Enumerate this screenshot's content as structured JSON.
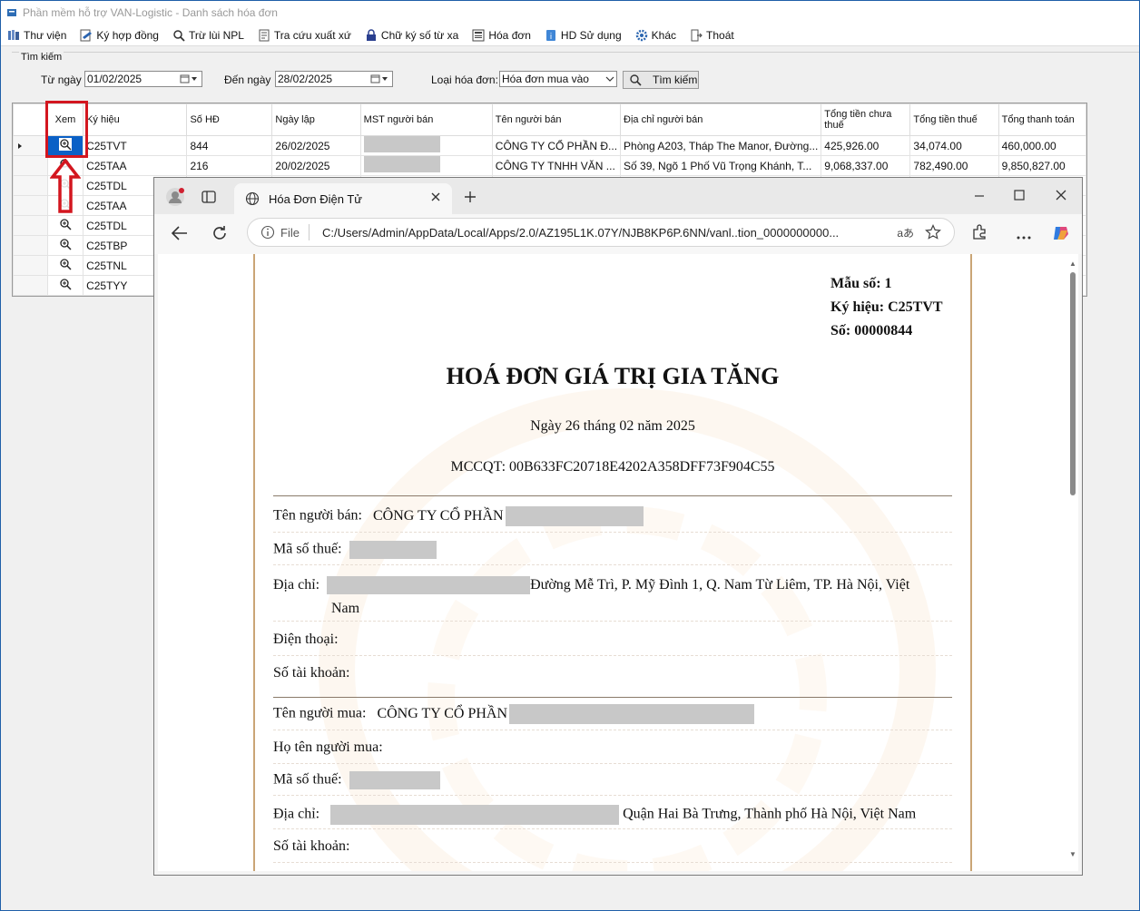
{
  "window": {
    "title": "Phần mềm hỗ trợ VAN-Logistic - Danh sách hóa đơn"
  },
  "menu": [
    {
      "label": "Thư viện",
      "icon": "library-icon"
    },
    {
      "label": "Ký hợp đồng",
      "icon": "sign-contract-icon"
    },
    {
      "label": "Trừ lùi NPL",
      "icon": "search-icon"
    },
    {
      "label": "Tra cứu xuất xứ",
      "icon": "document-icon"
    },
    {
      "label": "Chữ ký số từ xa",
      "icon": "lock-icon"
    },
    {
      "label": "Hóa đơn",
      "icon": "invoice-icon"
    },
    {
      "label": "HD Sử dụng",
      "icon": "help-icon"
    },
    {
      "label": "Khác",
      "icon": "gear-icon"
    },
    {
      "label": "Thoát",
      "icon": "exit-icon"
    }
  ],
  "search": {
    "legend": "Tìm kiếm",
    "from_label": "Từ ngày",
    "from_value": "01/02/2025",
    "to_label": "Đến ngày",
    "to_value": "28/02/2025",
    "type_label": "Loại hóa đơn:",
    "type_value": "Hóa đơn mua vào",
    "button_label": "Tìm kiếm"
  },
  "grid": {
    "columns": [
      "Xem",
      "Ký hiệu",
      "Số HĐ",
      "Ngày lập",
      "MST người bán",
      "Tên người bán",
      "Địa chỉ người bán",
      "Tổng tiền chưa thuế",
      "Tổng tiền thuế",
      "Tổng thanh toán"
    ],
    "rows": [
      {
        "kyhieu": "C25TVT",
        "sohd": "844",
        "ngaylap": "26/02/2025",
        "ten": "CÔNG TY CỔ PHẦN Đ...",
        "diachi": "Phòng A203, Tháp The Manor, Đường...",
        "chuathue": "425,926.00",
        "thue": "34,074.00",
        "tong": "460,000.00"
      },
      {
        "kyhieu": "C25TAA",
        "sohd": "216",
        "ngaylap": "20/02/2025",
        "ten": "CÔNG TY TNHH VĂN ...",
        "diachi": "Số 39, Ngõ 1 Phố Vũ Trọng Khánh, T...",
        "chuathue": "9,068,337.00",
        "thue": "782,490.00",
        "tong": "9,850,827.00"
      },
      {
        "kyhieu": "C25TDL"
      },
      {
        "kyhieu": "C25TAA"
      },
      {
        "kyhieu": "C25TDL"
      },
      {
        "kyhieu": "C25TBP"
      },
      {
        "kyhieu": "C25TNL"
      },
      {
        "kyhieu": "C25TYY"
      }
    ]
  },
  "browser": {
    "tab_title": "Hóa Đơn Điện Tử",
    "file_label": "File",
    "url": "C:/Users/Admin/AppData/Local/Apps/2.0/AZ195L1K.07Y/NJB8KP6P.6NN/vanl..tion_0000000000...",
    "read_aloud": "aあ"
  },
  "invoice": {
    "mau_so": "Mẫu số: 1",
    "ky_hieu": "Ký hiệu: C25TVT",
    "so": "Số: 00000844",
    "title": "HOÁ ĐƠN GIÁ TRỊ GIA TĂNG",
    "date": "Ngày 26 tháng 02 năm 2025",
    "mccqt": "MCCQT: 00B633FC20718E4202A358DFF73F904C55",
    "seller_name_label": "Tên người bán:",
    "seller_name": "CÔNG TY CỔ PHẦN",
    "seller_tax_label": "Mã số thuế:",
    "seller_addr_label": "Địa chỉ:",
    "seller_addr_visible": "Đường Mễ Trì, P. Mỹ Đình 1, Q. Nam Từ Liêm, TP. Hà Nội, Việt",
    "seller_addr_wrap": "Nam",
    "seller_phone_label": "Điện thoại:",
    "seller_account_label": "Số tài khoản:",
    "buyer_name_label": "Tên người mua:",
    "buyer_name": "CÔNG TY CỔ PHẦN",
    "buyer_person_label": "Họ tên người mua:",
    "buyer_tax_label": "Mã số thuế:",
    "buyer_addr_label": "Địa chỉ:",
    "buyer_addr_visible": "Quận Hai Bà Trưng, Thành phố Hà Nội, Việt Nam",
    "buyer_account_label": "Số tài khoản:"
  }
}
